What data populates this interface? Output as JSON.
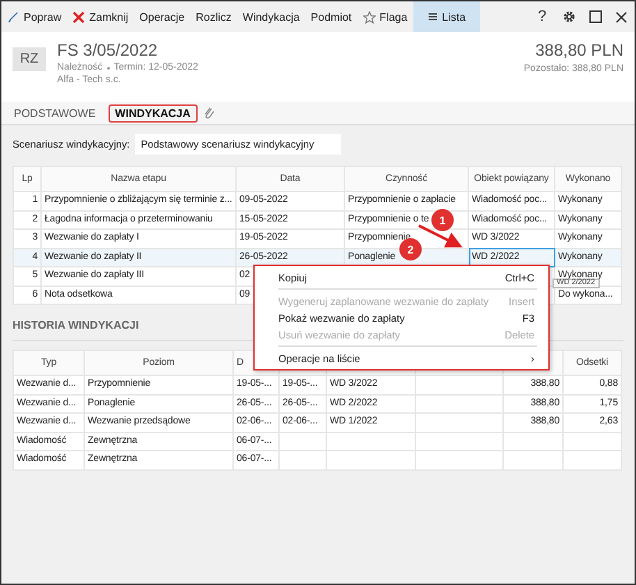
{
  "toolbar": {
    "items": [
      {
        "label": "Popraw",
        "selected": false
      },
      {
        "label": "Zamknij",
        "selected": false
      },
      {
        "label": "Operacje",
        "selected": false
      },
      {
        "label": "Rozlicz",
        "selected": false
      },
      {
        "label": "Windykacja",
        "selected": false
      },
      {
        "label": "Podmiot",
        "selected": false
      },
      {
        "label": "Flaga",
        "selected": false
      },
      {
        "label": "Lista",
        "selected": true
      }
    ],
    "help": "?"
  },
  "document": {
    "badge": "RZ",
    "title": "FS 3/05/2022",
    "type": "Należność",
    "due": "Termin: 12-05-2022",
    "contractor": "Alfa - Tech s.c.",
    "amount": "388,80 PLN",
    "remaining": "Pozostało: 388,80 PLN"
  },
  "tabs": [
    {
      "label": "PODSTAWOWE",
      "selected": false
    },
    {
      "label": "WINDYKACJA",
      "selected": true
    }
  ],
  "scenario": {
    "label": "Scenariusz windykacyjny:",
    "value": "Podstawowy scenariusz windykacyjny"
  },
  "stages": {
    "columns": [
      {
        "label": "Lp"
      },
      {
        "label": "Nazwa etapu"
      },
      {
        "label": "Data"
      },
      {
        "label": "Czynność"
      },
      {
        "label": "Obiekt powiązany"
      },
      {
        "label": "Wykonano"
      }
    ],
    "rows": [
      {
        "cells": [
          "1",
          "Przypomnienie o zbliżającym się terminie z...",
          "09-05-2022",
          "Przypomnienie o zapłacie",
          "Wiadomość poc...",
          "Wykonany"
        ],
        "selected": false,
        "focused": false
      },
      {
        "cells": [
          "2",
          "Łagodna informacja o przeterminowaniu",
          "15-05-2022",
          "Przypomnienie o te",
          "Wiadomość poc...",
          "Wykonany"
        ],
        "selected": false,
        "focused": false
      },
      {
        "cells": [
          "3",
          "Wezwanie do zapłaty I",
          "19-05-2022",
          "Przypomnienie",
          "WD 3/2022",
          "Wykonany"
        ],
        "selected": false,
        "focused": false
      },
      {
        "cells": [
          "4",
          "Wezwanie do zapłaty II",
          "26-05-2022",
          "Ponaglenie",
          "WD 2/2022",
          "Wykonany"
        ],
        "selected": true,
        "focused": true
      },
      {
        "cells": [
          "5",
          "Wezwanie do zapłaty III",
          "02",
          null,
          null,
          "Wykonany"
        ],
        "selected": false,
        "focused": false
      },
      {
        "cells": [
          "6",
          "Nota odsetkowa",
          "09",
          null,
          null,
          "Do wykona..."
        ],
        "selected": false,
        "focused": false
      }
    ]
  },
  "history": {
    "title": "HISTORIA WINDYKACJI",
    "columns": [
      {
        "label": "Typ"
      },
      {
        "label": "Poziom"
      },
      {
        "label": "D"
      },
      {},
      {},
      {},
      {},
      {
        "label": "Odsetki"
      }
    ],
    "rows": [
      {
        "cells": [
          "Wezwanie d...",
          "Przypomnienie",
          "19-05-...",
          "19-05-...",
          "WD 3/2022",
          null,
          "388,80",
          "0,88"
        ]
      },
      {
        "cells": [
          "Wezwanie d...",
          "Ponaglenie",
          "26-05-...",
          "26-05-...",
          "WD 2/2022",
          null,
          "388,80",
          "1,75"
        ]
      },
      {
        "cells": [
          "Wezwanie d...",
          "Wezwanie przedsądowe",
          "02-06-...",
          "02-06-...",
          "WD 1/2022",
          null,
          "388,80",
          "2,63"
        ]
      },
      {
        "cells": [
          "Wiadomość",
          "Zewnętrzna",
          "06-07-...",
          null,
          null,
          null,
          null,
          null
        ]
      },
      {
        "cells": [
          "Wiadomość",
          "Zewnętrzna",
          "06-07-...",
          null,
          null,
          null,
          null,
          null
        ]
      }
    ]
  },
  "context_menu": {
    "items": [
      {
        "kind": "item",
        "label": "Kopiuj",
        "shortcut": "Ctrl+C",
        "disabled": false
      },
      {
        "kind": "separator"
      },
      {
        "kind": "item",
        "label": "Wygeneruj zaplanowane wezwanie do zapłaty",
        "shortcut": "Insert",
        "disabled": true
      },
      {
        "kind": "item",
        "label": "Pokaż wezwanie do zapłaty",
        "shortcut": "F3",
        "disabled": false
      },
      {
        "kind": "item",
        "label": "Usuń wezwanie do zapłaty",
        "shortcut": "Delete",
        "disabled": true
      },
      {
        "kind": "separator"
      },
      {
        "kind": "submenu",
        "label": "Operacje na liście",
        "arrow": "›",
        "disabled": false
      }
    ]
  },
  "tooltip": "WD 2/2022",
  "annotations": {
    "markers": [
      {
        "label": "1"
      },
      {
        "label": "2"
      }
    ]
  }
}
